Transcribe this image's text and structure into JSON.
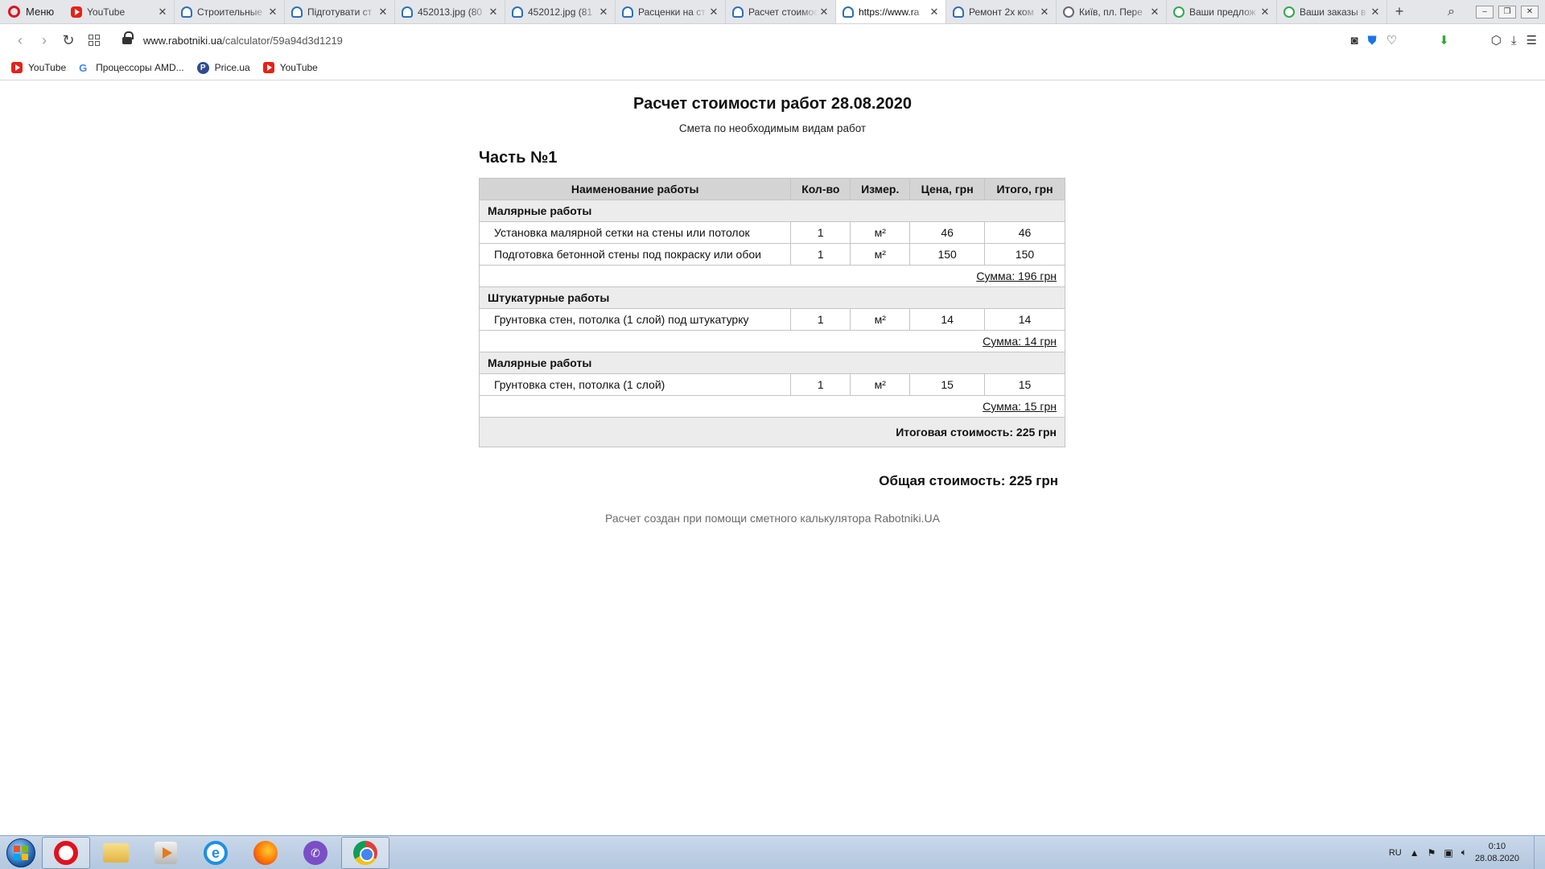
{
  "browser": {
    "menu_label": "Меню",
    "tabs": [
      {
        "icon": "youtube-icon",
        "title": "YouTube"
      },
      {
        "icon": "worker-icon",
        "title": "Строительные"
      },
      {
        "icon": "worker-icon",
        "title": "Підготувати ст"
      },
      {
        "icon": "worker-icon",
        "title": "452013.jpg (80"
      },
      {
        "icon": "worker-icon",
        "title": "452012.jpg (81"
      },
      {
        "icon": "worker-icon",
        "title": "Расценки на ст"
      },
      {
        "icon": "worker-icon",
        "title": "Расчет стоимос"
      },
      {
        "icon": "worker-icon",
        "title": "https://www.ra"
      },
      {
        "icon": "worker-icon",
        "title": "Ремонт 2х ком"
      },
      {
        "icon": "globe-icon",
        "title": "Київ, пл. Пере"
      },
      {
        "icon": "cloud-icon",
        "title": "Ваши предлож"
      },
      {
        "icon": "cloud-icon",
        "title": "Ваши заказы в"
      }
    ],
    "active_tab_index": 7,
    "new_tab_label": "+",
    "url_host": "www.rabotniki.ua",
    "url_path": "/calculator/59a94d3d1219",
    "bookmarks": [
      {
        "icon": "youtube-icon",
        "label": "YouTube"
      },
      {
        "icon": "google-icon",
        "label": "Процессоры AMD..."
      },
      {
        "icon": "price-icon",
        "label": "Price.ua"
      },
      {
        "icon": "youtube-icon",
        "label": "YouTube"
      }
    ]
  },
  "estimate": {
    "title": "Расчет стоимости работ 28.08.2020",
    "subtitle": "Смета по необходимым видам работ",
    "part_title": "Часть №1",
    "headers": {
      "name": "Наименование работы",
      "qty": "Кол-во",
      "unit": "Измер.",
      "price": "Цена, грн",
      "total": "Итого, грн"
    },
    "groups": [
      {
        "name": "Малярные работы",
        "rows": [
          {
            "name": "Установка малярной сетки на стены или потолок",
            "qty": "1",
            "unit": "м²",
            "price": "46",
            "total": "46"
          },
          {
            "name": "Подготовка бетонной стены под покраску или обои",
            "qty": "1",
            "unit": "м²",
            "price": "150",
            "total": "150"
          }
        ],
        "sum": "Сумма: 196 грн"
      },
      {
        "name": "Штукатурные работы",
        "rows": [
          {
            "name": "Грунтовка стен, потолка (1 слой) под штукатурку",
            "qty": "1",
            "unit": "м²",
            "price": "14",
            "total": "14"
          }
        ],
        "sum": "Сумма: 14 грн"
      },
      {
        "name": "Малярные работы",
        "rows": [
          {
            "name": "Грунтовка стен, потолка (1 слой)",
            "qty": "1",
            "unit": "м²",
            "price": "15",
            "total": "15"
          }
        ],
        "sum": "Сумма: 15 грн"
      }
    ],
    "grand_total": "Итоговая стоимость: 225 грн",
    "overall_total": "Общая стоимость: 225 грн",
    "credit": "Расчет создан при помощи сметного калькулятора Rabotniki.UA"
  },
  "taskbar": {
    "apps": [
      {
        "icon": "opera-icon",
        "pinned": true
      },
      {
        "icon": "folder-icon",
        "pinned": false
      },
      {
        "icon": "media-player-icon",
        "pinned": false
      },
      {
        "icon": "internet-explorer-icon",
        "pinned": false
      },
      {
        "icon": "firefox-icon",
        "pinned": false
      },
      {
        "icon": "viber-icon",
        "pinned": false
      },
      {
        "icon": "chrome-icon",
        "pinned": true
      }
    ],
    "language": "RU",
    "time": "0:10",
    "date": "28.08.2020"
  },
  "colors": {
    "header_bg": "#d4d4d4",
    "group_bg": "#ececec",
    "opera_red": "#e0121f"
  }
}
